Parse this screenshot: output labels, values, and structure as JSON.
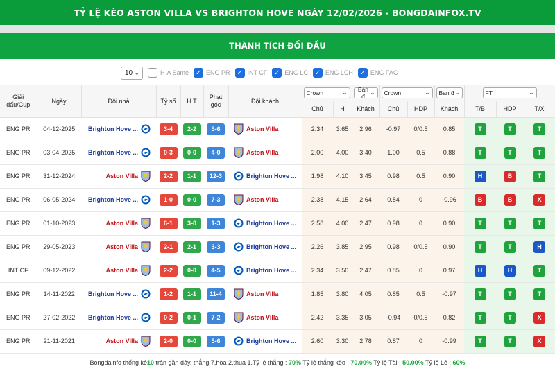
{
  "page_title": "TỶ LỆ KÈO ASTON VILLA VS BRIGHTON HOVE NGÀY 12/02/2026 - BONGDAINFOX.TV",
  "section_title": "THÀNH TÍCH ĐỐI ĐẦU",
  "filters": {
    "count": "10",
    "items": [
      {
        "label": "H-A Same",
        "checked": false
      },
      {
        "label": "ENG PR",
        "checked": true
      },
      {
        "label": "INT CF",
        "checked": true
      },
      {
        "label": "ENG LC",
        "checked": true
      },
      {
        "label": "ENG LCH",
        "checked": true
      },
      {
        "label": "ENG FAC",
        "checked": true
      }
    ]
  },
  "headers": {
    "league": "Giải đấu/Cup",
    "date": "Ngày",
    "home": "Đội nhà",
    "score": "Tỷ số",
    "ht": "H T",
    "corner": "Phạt góc",
    "away": "Đội khách",
    "select1": "Crown",
    "select2": "Ban đ",
    "select3": "Crown",
    "select4": "Ban đ",
    "select5": "FT",
    "sub": [
      "Chủ",
      "H",
      "Khách",
      "Chủ",
      "HDP",
      "Khách",
      "T/B",
      "HDP",
      "T/X"
    ]
  },
  "rows": [
    {
      "league": "ENG PR",
      "date": "04-12-2025",
      "home": "Brighton Hove ...",
      "home_team": "brighton",
      "score": "3-4",
      "ht": "2-2",
      "corner": "5-6",
      "away": "Aston Villa",
      "away_team": "villa",
      "o1": "2.34",
      "o2": "3.65",
      "o3": "2.96",
      "h1": "-0.97",
      "h2": "0/0.5",
      "h3": "0.85",
      "tb": "T",
      "hdp": "T",
      "tx": "T"
    },
    {
      "league": "ENG PR",
      "date": "03-04-2025",
      "home": "Brighton Hove ...",
      "home_team": "brighton",
      "score": "0-3",
      "ht": "0-0",
      "corner": "4-0",
      "away": "Aston Villa",
      "away_team": "villa",
      "o1": "2.00",
      "o2": "4.00",
      "o3": "3.40",
      "h1": "1.00",
      "h2": "0.5",
      "h3": "0.88",
      "tb": "T",
      "hdp": "T",
      "tx": "T"
    },
    {
      "league": "ENG PR",
      "date": "31-12-2024",
      "home": "Aston Villa",
      "home_team": "villa",
      "score": "2-2",
      "ht": "1-1",
      "corner": "12-3",
      "away": "Brighton Hove ...",
      "away_team": "brighton",
      "o1": "1.98",
      "o2": "4.10",
      "o3": "3.45",
      "h1": "0.98",
      "h2": "0.5",
      "h3": "0.90",
      "tb": "H",
      "hdp": "B",
      "tx": "T"
    },
    {
      "league": "ENG PR",
      "date": "06-05-2024",
      "home": "Brighton Hove ...",
      "home_team": "brighton",
      "score": "1-0",
      "ht": "0-0",
      "corner": "7-3",
      "away": "Aston Villa",
      "away_team": "villa",
      "o1": "2.38",
      "o2": "4.15",
      "o3": "2.64",
      "h1": "0.84",
      "h2": "0",
      "h3": "-0.96",
      "tb": "B",
      "hdp": "B",
      "tx": "X"
    },
    {
      "league": "ENG PR",
      "date": "01-10-2023",
      "home": "Aston Villa",
      "home_team": "villa",
      "score": "6-1",
      "ht": "3-0",
      "corner": "1-3",
      "away": "Brighton Hove ...",
      "away_team": "brighton",
      "o1": "2.58",
      "o2": "4.00",
      "o3": "2.47",
      "h1": "0.98",
      "h2": "0",
      "h3": "0.90",
      "tb": "T",
      "hdp": "T",
      "tx": "T"
    },
    {
      "league": "ENG PR",
      "date": "29-05-2023",
      "home": "Aston Villa",
      "home_team": "villa",
      "score": "2-1",
      "ht": "2-1",
      "corner": "3-3",
      "away": "Brighton Hove ...",
      "away_team": "brighton",
      "o1": "2.26",
      "o2": "3.85",
      "o3": "2.95",
      "h1": "0.98",
      "h2": "0/0.5",
      "h3": "0.90",
      "tb": "T",
      "hdp": "T",
      "tx": "H"
    },
    {
      "league": "INT CF",
      "date": "09-12-2022",
      "home": "Aston Villa",
      "home_team": "villa",
      "score": "2-2",
      "ht": "0-0",
      "corner": "4-5",
      "away": "Brighton Hove ...",
      "away_team": "brighton",
      "o1": "2.34",
      "o2": "3.50",
      "o3": "2.47",
      "h1": "0.85",
      "h2": "0",
      "h3": "0.97",
      "tb": "H",
      "hdp": "H",
      "tx": "T"
    },
    {
      "league": "ENG PR",
      "date": "14-11-2022",
      "home": "Brighton Hove ...",
      "home_team": "brighton",
      "score": "1-2",
      "ht": "1-1",
      "corner": "11-4",
      "away": "Aston Villa",
      "away_team": "villa",
      "o1": "1.85",
      "o2": "3.80",
      "o3": "4.05",
      "h1": "0.85",
      "h2": "0.5",
      "h3": "-0.97",
      "tb": "T",
      "hdp": "T",
      "tx": "T"
    },
    {
      "league": "ENG PR",
      "date": "27-02-2022",
      "home": "Brighton Hove ...",
      "home_team": "brighton",
      "score": "0-2",
      "ht": "0-1",
      "corner": "7-2",
      "away": "Aston Villa",
      "away_team": "villa",
      "o1": "2.42",
      "o2": "3.35",
      "o3": "3.05",
      "h1": "-0.94",
      "h2": "0/0.5",
      "h3": "0.82",
      "tb": "T",
      "hdp": "T",
      "tx": "X"
    },
    {
      "league": "ENG PR",
      "date": "21-11-2021",
      "home": "Aston Villa",
      "home_team": "villa",
      "score": "2-0",
      "ht": "0-0",
      "corner": "5-6",
      "away": "Brighton Hove ...",
      "away_team": "brighton",
      "o1": "2.60",
      "o2": "3.30",
      "o3": "2.78",
      "h1": "0.87",
      "h2": "0",
      "h3": "-0.99",
      "tb": "T",
      "hdp": "T",
      "tx": "X"
    }
  ],
  "footer": {
    "part1": "Bongdainfo thống kê ",
    "n": "10",
    "part2": " trận gần đây, thắng 7,hòa 2,thua 1.Tỷ lệ thắng : ",
    "win": "70%",
    "part3": " Tỷ lệ thắng kèo : ",
    "winodds": "70.00%",
    "part4": " Tỷ lệ Tài : ",
    "over": "50.00%",
    "part5": " Tỷ lệ Lẻ : ",
    "odd": "60%"
  },
  "colors": {
    "header_green": "#0a9c3a",
    "win_badge": "#1fa33c",
    "draw_badge": "#1a57c9",
    "loss_badge": "#d92b2b"
  }
}
